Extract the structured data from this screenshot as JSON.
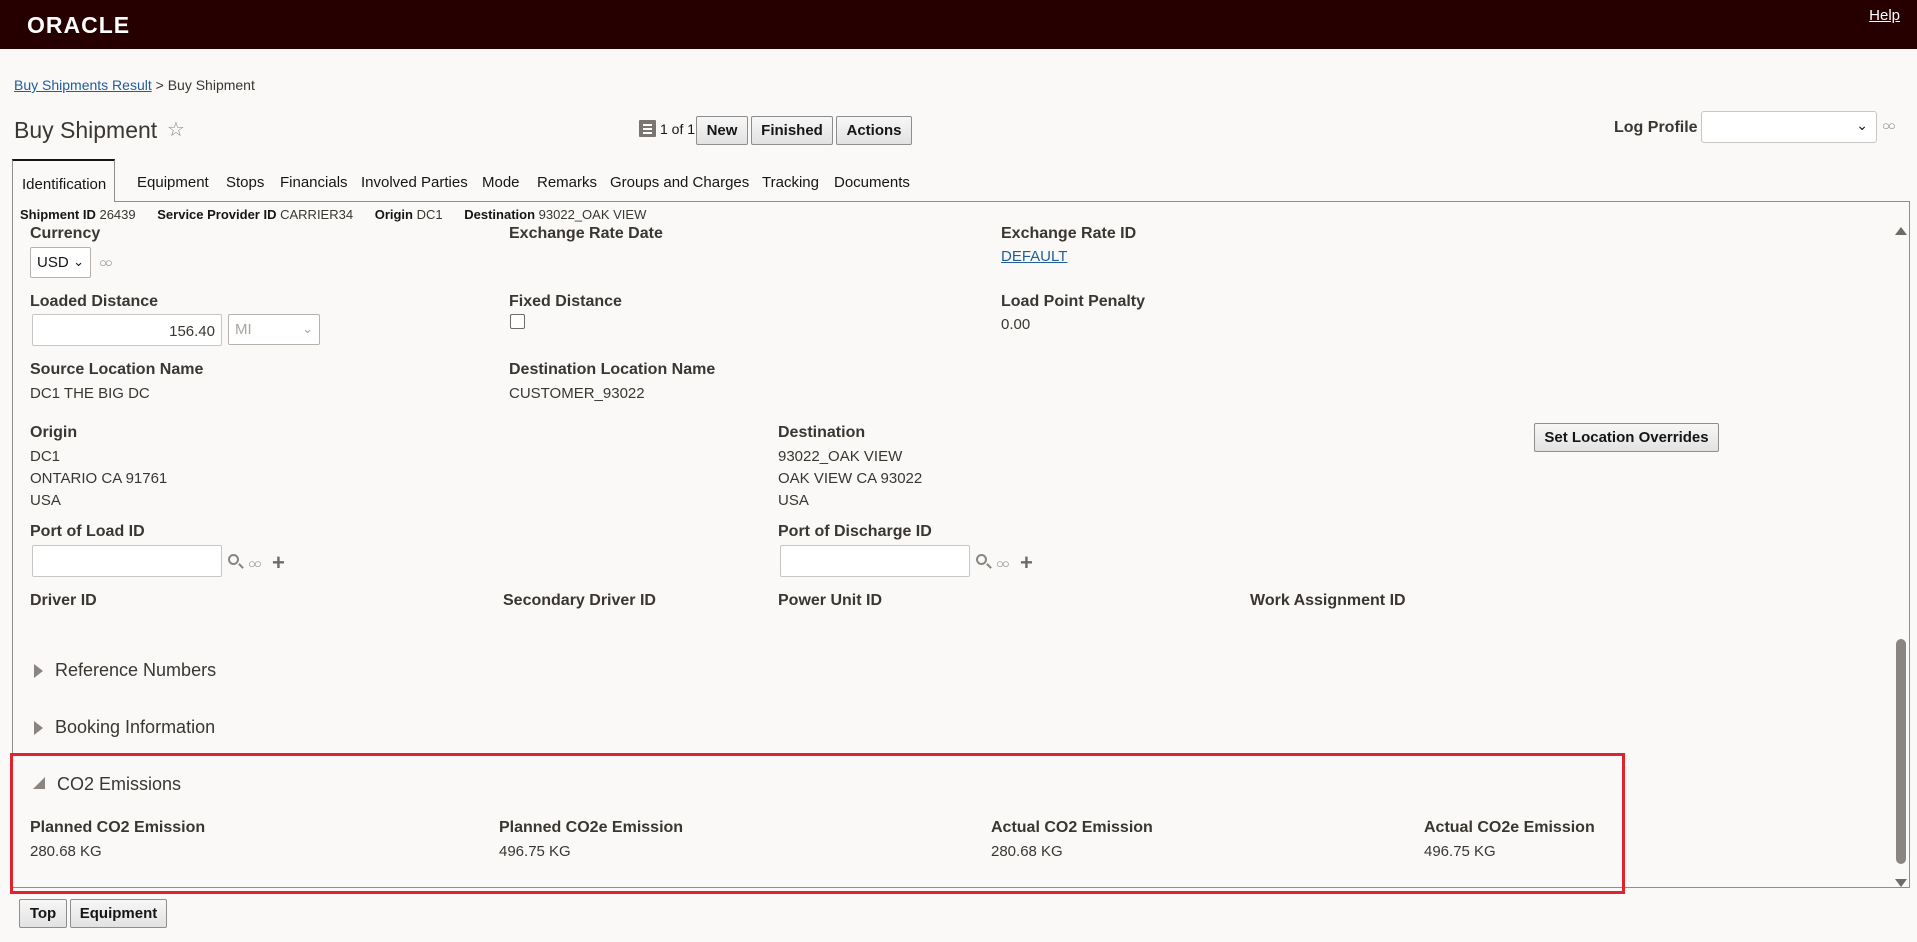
{
  "header": {
    "logo": "ORACLE",
    "help": "Help"
  },
  "breadcrumb": {
    "link": "Buy Shipments Result",
    "separator": ">",
    "current": "Buy Shipment"
  },
  "page": {
    "title": "Buy Shipment"
  },
  "pager": {
    "text": "1 of 1"
  },
  "toolbar": {
    "new": "New",
    "finished": "Finished",
    "actions": "Actions"
  },
  "log_profile": {
    "label": "Log Profile",
    "value": ""
  },
  "tabs": [
    "Identification",
    "Equipment",
    "Stops",
    "Financials",
    "Involved Parties",
    "Mode",
    "Remarks",
    "Groups and Charges",
    "Tracking",
    "Documents"
  ],
  "summary": {
    "shipment_id_label": "Shipment ID",
    "shipment_id": "26439",
    "provider_label": "Service Provider ID",
    "provider": "CARRIER34",
    "origin_label": "Origin",
    "origin": "DC1",
    "destination_label": "Destination",
    "destination": "93022_OAK VIEW"
  },
  "fields": {
    "currency_label": "Currency",
    "currency": "USD",
    "exchange_rate_date_label": "Exchange Rate Date",
    "exchange_rate_id_label": "Exchange Rate ID",
    "exchange_rate_id": "DEFAULT",
    "loaded_distance_label": "Loaded Distance",
    "loaded_distance": "156.40",
    "distance_uom": "MI",
    "fixed_distance_label": "Fixed Distance",
    "load_point_penalty_label": "Load Point Penalty",
    "load_point_penalty": "0.00",
    "source_location_label": "Source Location Name",
    "source_location": "DC1 THE BIG DC",
    "dest_location_label": "Destination Location Name",
    "dest_location": "CUSTOMER_93022",
    "origin_label": "Origin",
    "origin_line1": "DC1",
    "origin_line2": "ONTARIO CA 91761",
    "origin_line3": "USA",
    "destination_label": "Destination",
    "dest_line1": "93022_OAK VIEW",
    "dest_line2": "OAK VIEW CA 93022",
    "dest_line3": "USA",
    "set_overrides": "Set Location Overrides",
    "port_load_label": "Port of Load ID",
    "port_discharge_label": "Port of Discharge ID",
    "driver_label": "Driver ID",
    "secondary_driver_label": "Secondary Driver ID",
    "power_unit_label": "Power Unit ID",
    "work_assignment_label": "Work Assignment ID"
  },
  "sections": {
    "reference": "Reference Numbers",
    "booking": "Booking Information",
    "co2": "CO2 Emissions"
  },
  "emissions": {
    "planned_co2_label": "Planned CO2 Emission",
    "planned_co2": "280.68 KG",
    "planned_co2e_label": "Planned CO2e Emission",
    "planned_co2e": "496.75 KG",
    "actual_co2_label": "Actual CO2 Emission",
    "actual_co2": "280.68 KG",
    "actual_co2e_label": "Actual CO2e Emission",
    "actual_co2e": "496.75 KG"
  },
  "footer": {
    "top": "Top",
    "equipment": "Equipment"
  },
  "colors": {
    "header_bg": "#260000",
    "highlight": "#e0242e",
    "link": "#1f5d9b"
  }
}
